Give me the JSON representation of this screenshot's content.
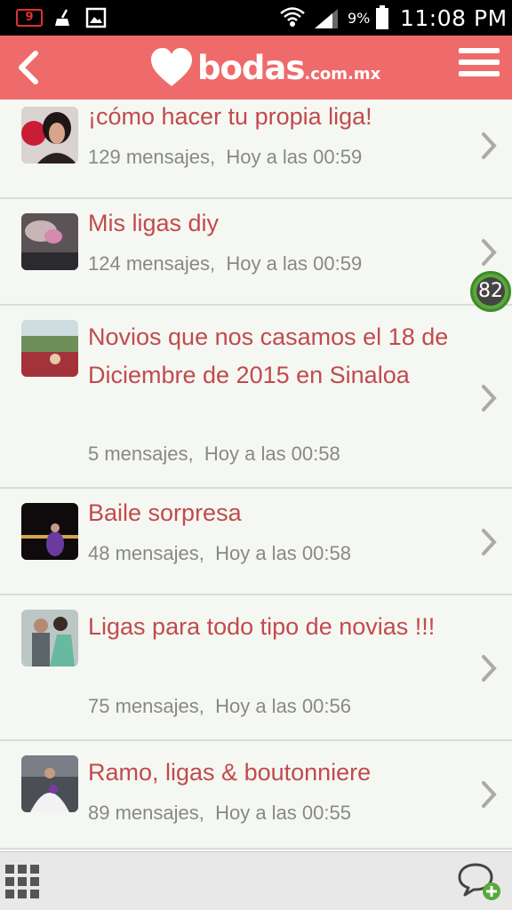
{
  "status_bar": {
    "notification_count": "9",
    "battery_percent": "9%",
    "time": "11:08 PM"
  },
  "header": {
    "logo_name": "bodas",
    "logo_tld": ".com.mx"
  },
  "threads": [
    {
      "title": "¡cómo hacer tu propia liga!",
      "messages": "129 mensajes,",
      "time": "Hoy a las 00:59"
    },
    {
      "title": "Mis ligas diy",
      "messages": "124 mensajes,",
      "time": "Hoy a las 00:59"
    },
    {
      "title": "Novios que nos casamos el 18 de Diciembre de 2015 en Sinaloa",
      "messages": "5 mensajes,",
      "time": "Hoy a las 00:58"
    },
    {
      "title": "Baile sorpresa",
      "messages": "48 mensajes,",
      "time": "Hoy a las 00:58"
    },
    {
      "title": "Ligas para todo tipo de novias !!!",
      "messages": "75 mensajes,",
      "time": "Hoy a las 00:56"
    },
    {
      "title": "Ramo, ligas & boutonniere",
      "messages": "89 mensajes,",
      "time": "Hoy a las 00:55"
    }
  ],
  "floating_badge": "82",
  "colors": {
    "header": "#ef6b6b",
    "title_text": "#c24a4d",
    "meta_text": "#888888",
    "background": "#f5f8f2"
  }
}
